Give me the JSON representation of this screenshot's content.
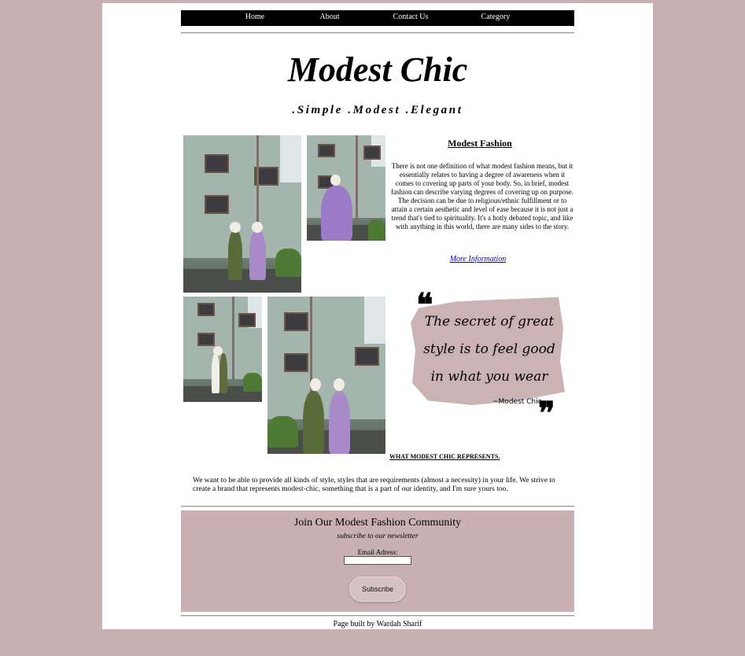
{
  "nav": {
    "items": [
      {
        "label": "Home"
      },
      {
        "label": "About"
      },
      {
        "label": "Contact Us"
      },
      {
        "label": "Category"
      }
    ]
  },
  "header": {
    "title": "Modest Chic",
    "tagline": ".Simple .Modest .Elegant"
  },
  "intro": {
    "heading": "Modest Fashion",
    "body": "There is not one definition of what modest fashion means, but it essentially relates to having a degree of awareness when it comes to covering up parts of your body. So, in brief, modest fashion can describe varying degrees of covering up on purpose. The decision can be due to religious/ethnic fulfillment or to attain a certain aesthetic and level of ease because it is not just a trend that's tied to spirituality. It's a hotly debated topic, and like with anything in this world, there are many sides to the story.",
    "link": "More Information"
  },
  "quote": {
    "text": "The secret of great style is to feel good in what you wear",
    "attribution": "~Modest Chic"
  },
  "represents": {
    "heading": "WHAT MODEST CHIC REPRESENTS.",
    "body": "We want to be able to provide all kinds of style, styles that are requirements (almost a necessity) in your life. We strive to create a brand that represents modest-chic, something that is a part of our identity, and I'm sure yours too."
  },
  "newsletter": {
    "title": "Join Our Modest Fashion Community",
    "subtitle": "subscribe to our newsletter",
    "email_label": "Email Adress:",
    "email_value": "",
    "button": "Subscribe"
  },
  "footer": {
    "text": "Page built by Wardah Sharif"
  },
  "colors": {
    "background": "#c9b0b2",
    "navbar": "#000000",
    "link": "#0000cc",
    "accent": "#cbb2b3"
  }
}
